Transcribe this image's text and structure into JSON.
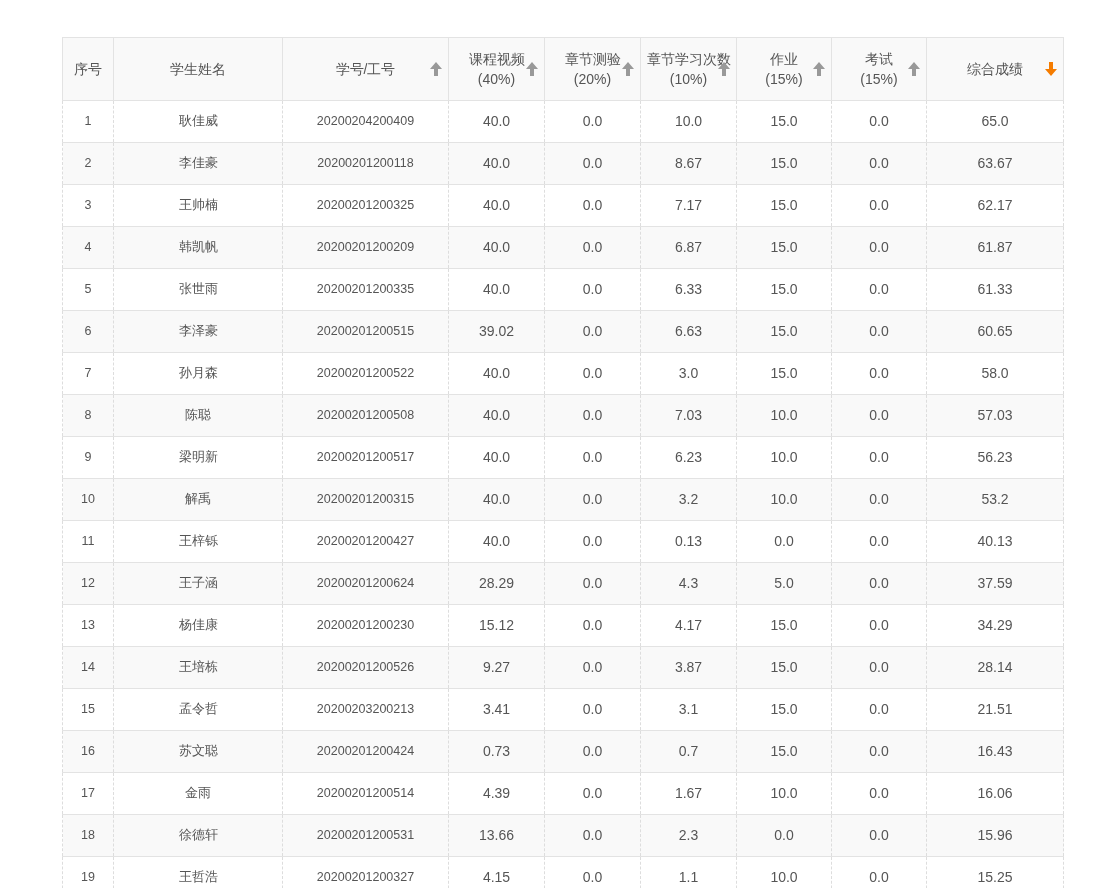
{
  "table": {
    "columns": [
      {
        "label": "序号"
      },
      {
        "label": "学生姓名"
      },
      {
        "label": "学号/工号",
        "sorted": false
      },
      {
        "label": "课程视频",
        "sub": "(40%)",
        "sorted": false
      },
      {
        "label": "章节测验",
        "sub": "(20%)",
        "sorted": false
      },
      {
        "label": "章节学习次数",
        "sub": "(10%)",
        "sorted": false
      },
      {
        "label": "作业",
        "sub": "(15%)",
        "sorted": false
      },
      {
        "label": "考试",
        "sub": "(15%)",
        "sorted": false
      },
      {
        "label": "综合成绩",
        "sorted": true
      }
    ],
    "rows": [
      [
        "1",
        "耿佳威",
        "20200204200409",
        "40.0",
        "0.0",
        "10.0",
        "15.0",
        "0.0",
        "65.0"
      ],
      [
        "2",
        "李佳豪",
        "20200201200118",
        "40.0",
        "0.0",
        "8.67",
        "15.0",
        "0.0",
        "63.67"
      ],
      [
        "3",
        "王帅楠",
        "20200201200325",
        "40.0",
        "0.0",
        "7.17",
        "15.0",
        "0.0",
        "62.17"
      ],
      [
        "4",
        "韩凯帆",
        "20200201200209",
        "40.0",
        "0.0",
        "6.87",
        "15.0",
        "0.0",
        "61.87"
      ],
      [
        "5",
        "张世雨",
        "20200201200335",
        "40.0",
        "0.0",
        "6.33",
        "15.0",
        "0.0",
        "61.33"
      ],
      [
        "6",
        "李泽豪",
        "20200201200515",
        "39.02",
        "0.0",
        "6.63",
        "15.0",
        "0.0",
        "60.65"
      ],
      [
        "7",
        "孙月森",
        "20200201200522",
        "40.0",
        "0.0",
        "3.0",
        "15.0",
        "0.0",
        "58.0"
      ],
      [
        "8",
        "陈聪",
        "20200201200508",
        "40.0",
        "0.0",
        "7.03",
        "10.0",
        "0.0",
        "57.03"
      ],
      [
        "9",
        "梁明新",
        "20200201200517",
        "40.0",
        "0.0",
        "6.23",
        "10.0",
        "0.0",
        "56.23"
      ],
      [
        "10",
        "解禹",
        "20200201200315",
        "40.0",
        "0.0",
        "3.2",
        "10.0",
        "0.0",
        "53.2"
      ],
      [
        "11",
        "王梓铄",
        "20200201200427",
        "40.0",
        "0.0",
        "0.13",
        "0.0",
        "0.0",
        "40.13"
      ],
      [
        "12",
        "王子涵",
        "20200201200624",
        "28.29",
        "0.0",
        "4.3",
        "5.0",
        "0.0",
        "37.59"
      ],
      [
        "13",
        "杨佳康",
        "20200201200230",
        "15.12",
        "0.0",
        "4.17",
        "15.0",
        "0.0",
        "34.29"
      ],
      [
        "14",
        "王培栋",
        "20200201200526",
        "9.27",
        "0.0",
        "3.87",
        "15.0",
        "0.0",
        "28.14"
      ],
      [
        "15",
        "孟令哲",
        "20200203200213",
        "3.41",
        "0.0",
        "3.1",
        "15.0",
        "0.0",
        "21.51"
      ],
      [
        "16",
        "苏文聪",
        "20200201200424",
        "0.73",
        "0.0",
        "0.7",
        "15.0",
        "0.0",
        "16.43"
      ],
      [
        "17",
        "金雨",
        "20200201200514",
        "4.39",
        "0.0",
        "1.67",
        "10.0",
        "0.0",
        "16.06"
      ],
      [
        "18",
        "徐德轩",
        "20200201200531",
        "13.66",
        "0.0",
        "2.3",
        "0.0",
        "0.0",
        "15.96"
      ],
      [
        "19",
        "王哲浩",
        "20200201200327",
        "4.15",
        "0.0",
        "1.1",
        "10.0",
        "0.0",
        "15.25"
      ]
    ]
  }
}
